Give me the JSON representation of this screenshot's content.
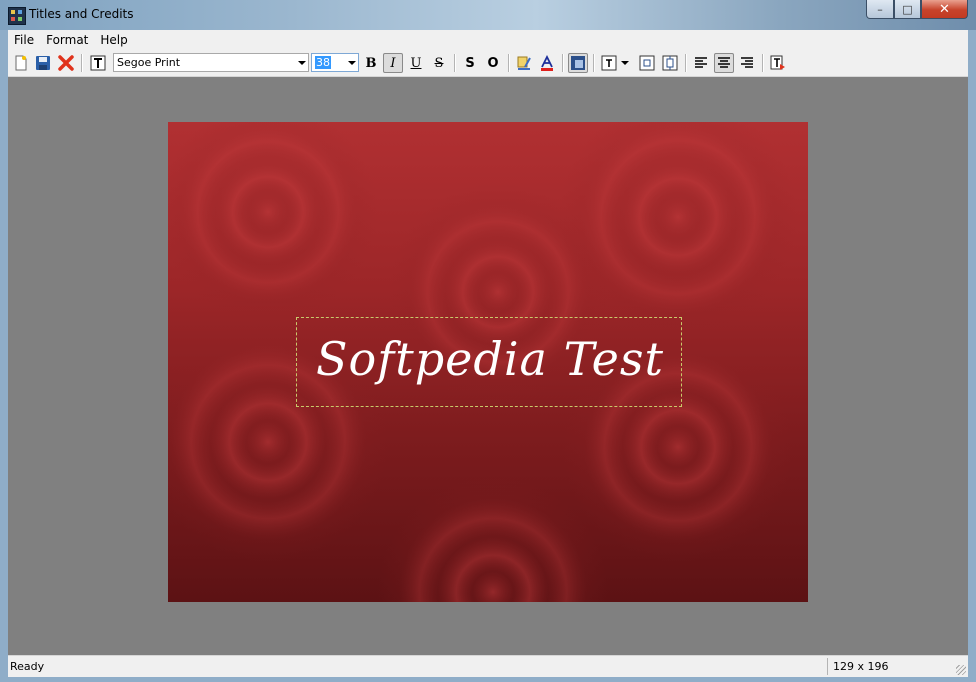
{
  "window": {
    "title": "Titles and Credits",
    "min_glyph": "–",
    "max_glyph": "□",
    "close_glyph": "✕"
  },
  "menu": [
    {
      "label": "File"
    },
    {
      "label": "Format"
    },
    {
      "label": "Help"
    }
  ],
  "toolbar": {
    "font_name": "Segoe Print",
    "font_size": "38",
    "bold": "B",
    "italic": "I",
    "underline": "U",
    "strike": "S",
    "shadow": "S",
    "outline": "O",
    "italic_pressed": true
  },
  "canvas": {
    "text": "Softpedia Test",
    "text_color": "#ffffff",
    "background_top": "#b13032",
    "background_bottom": "#5c1214"
  },
  "status": {
    "left": "Ready",
    "right": "129 x 196"
  },
  "icons": [
    "new-document-icon",
    "save-icon",
    "delete-icon",
    "text-tool-icon",
    "text-color-icon",
    "font-color-icon",
    "background-icon",
    "text-frame-icon",
    "align-left-icon",
    "align-center-icon",
    "align-right-icon",
    "insert-text-icon"
  ]
}
